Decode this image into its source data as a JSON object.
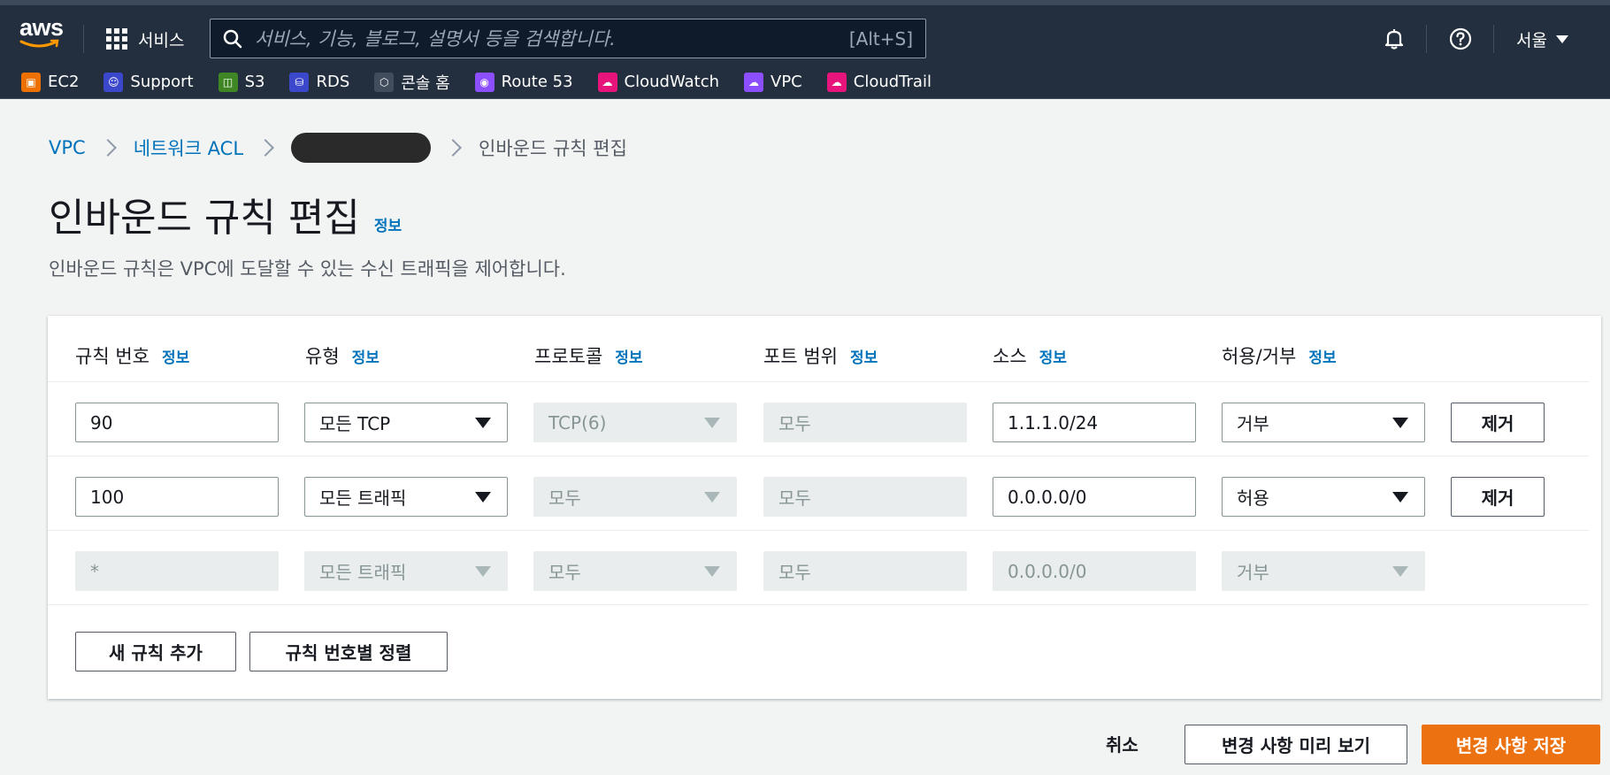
{
  "topnav": {
    "logo_text": "aws",
    "services_label": "서비스",
    "search_placeholder": "서비스, 기능, 블로그, 설명서 등을 검색합니다.",
    "search_shortcut": "[Alt+S]",
    "region": "서울"
  },
  "favorites": [
    {
      "label": "EC2",
      "icon": "ec2-icon",
      "color": "#ed7100"
    },
    {
      "label": "Support",
      "icon": "support-icon",
      "color": "#3b48cc"
    },
    {
      "label": "S3",
      "icon": "s3-icon",
      "color": "#3f8624"
    },
    {
      "label": "RDS",
      "icon": "rds-icon",
      "color": "#3b48cc"
    },
    {
      "label": "콘솔 홈",
      "icon": "console-home-icon",
      "color": "#414d5c"
    },
    {
      "label": "Route 53",
      "icon": "route53-icon",
      "color": "#8c4fff"
    },
    {
      "label": "CloudWatch",
      "icon": "cloudwatch-icon",
      "color": "#e7157b"
    },
    {
      "label": "VPC",
      "icon": "vpc-icon",
      "color": "#8c4fff"
    },
    {
      "label": "CloudTrail",
      "icon": "cloudtrail-icon",
      "color": "#e7157b"
    }
  ],
  "breadcrumb": {
    "vpc": "VPC",
    "nacl": "네트워크 ACL",
    "current": "인바운드 규칙 편집"
  },
  "page": {
    "title": "인바운드 규칙 편집",
    "info": "정보",
    "description": "인바운드 규칙은 VPC에 도달할 수 있는 수신 트래픽을 제어합니다."
  },
  "table": {
    "info": "정보",
    "headers": {
      "rule_number": "규칙 번호",
      "type": "유형",
      "protocol": "프로토콜",
      "port_range": "포트 범위",
      "source": "소스",
      "allow_deny": "허용/거부"
    },
    "rows": [
      {
        "rule_number": "90",
        "type": "모든 TCP",
        "protocol": "TCP(6)",
        "port_range": "모두",
        "source": "1.1.1.0/24",
        "allow_deny": "거부",
        "remove": "제거"
      },
      {
        "rule_number": "100",
        "type": "모든 트래픽",
        "protocol": "모두",
        "port_range": "모두",
        "source": "0.0.0.0/0",
        "allow_deny": "허용",
        "remove": "제거"
      },
      {
        "rule_number": "*",
        "type": "모든 트래픽",
        "protocol": "모두",
        "port_range": "모두",
        "source": "0.0.0.0/0",
        "allow_deny": "거부"
      }
    ],
    "add_rule": "새 규칙 추가",
    "sort_rules": "규칙 번호별 정렬"
  },
  "footer": {
    "cancel": "취소",
    "preview": "변경 사항 미리 보기",
    "save": "변경 사항 저장"
  },
  "colors": {
    "nav_bg": "#232f3e",
    "link": "#0073bb",
    "primary": "#ec7211"
  }
}
